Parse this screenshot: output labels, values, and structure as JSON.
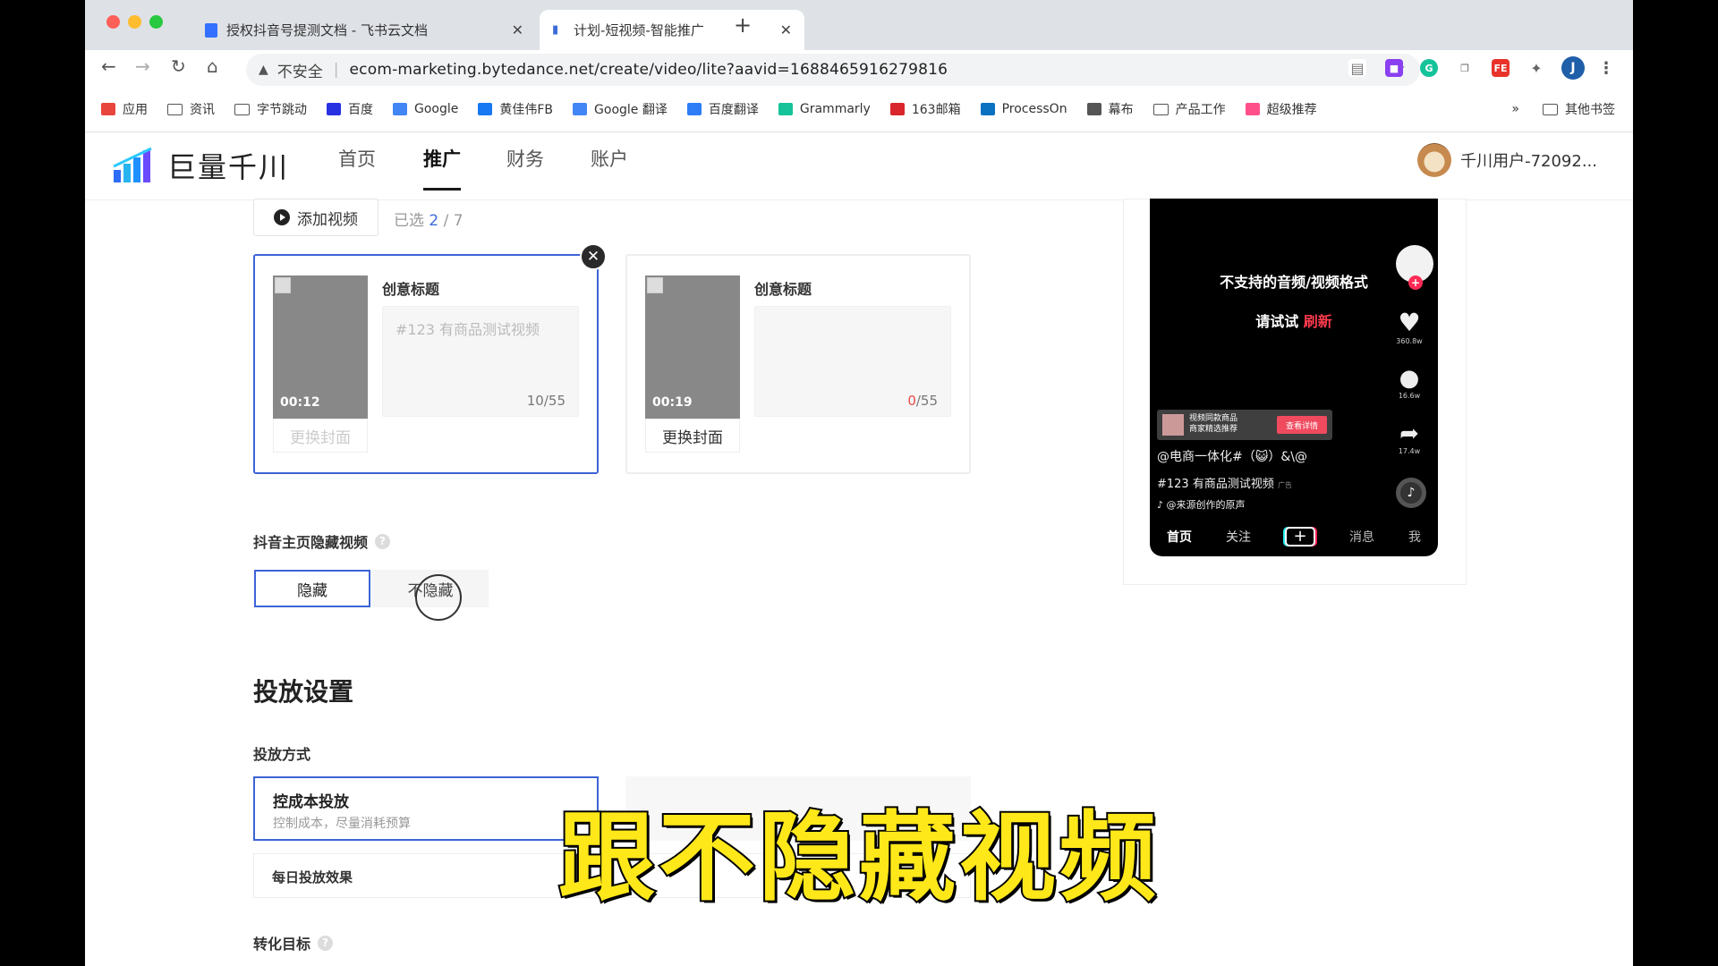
{
  "browser": {
    "tabs": [
      {
        "title": "授权抖音号提测文档 - 飞书云文档",
        "favicon_color": "#3370ff"
      },
      {
        "title": "计划-短视频-智能推广",
        "favicon_color": "#3b6bd8"
      }
    ],
    "security_label": "不安全",
    "url": "ecom-marketing.bytedance.net/create/video/lite?aavid=1688465916279816",
    "profile_initial": "J",
    "bookmarks": [
      {
        "label": "应用",
        "icon": "apps-grid-icon"
      },
      {
        "label": "资讯",
        "icon": "folder-icon"
      },
      {
        "label": "字节跳动",
        "icon": "folder-icon"
      },
      {
        "label": "百度",
        "icon": "baidu-icon"
      },
      {
        "label": "Google",
        "icon": "google-icon"
      },
      {
        "label": "黄佳伟FB",
        "icon": "facebook-icon"
      },
      {
        "label": "Google 翻译",
        "icon": "google-translate-icon"
      },
      {
        "label": "百度翻译",
        "icon": "baidu-translate-icon"
      },
      {
        "label": "Grammarly",
        "icon": "grammarly-icon"
      },
      {
        "label": "163邮箱",
        "icon": "mail163-icon"
      },
      {
        "label": "ProcessOn",
        "icon": "processon-icon"
      },
      {
        "label": "幕布",
        "icon": "mubu-icon"
      },
      {
        "label": "产品工作",
        "icon": "folder-icon"
      },
      {
        "label": "超级推荐",
        "icon": "share-icon"
      }
    ],
    "bookmarks_more": "»",
    "other_bookmarks": "其他书签"
  },
  "app": {
    "brand": "巨量千川",
    "nav": [
      "首页",
      "推广",
      "财务",
      "账户"
    ],
    "active_nav": "推广",
    "user_name": "千川用户-72092..."
  },
  "videos": {
    "add_label": "添加视频",
    "selected_prefix": "已选",
    "selected_count": "2",
    "selected_total": "/ 7",
    "cards": [
      {
        "duration": "00:12",
        "title_label": "创意标题",
        "text": "#123 有商品测试视频",
        "count_num": "10",
        "count_total": "/55",
        "cover_label": "更换封面"
      },
      {
        "duration": "00:19",
        "title_label": "创意标题",
        "text": "",
        "count_num": "0",
        "count_total": "/55",
        "cover_label": "更换封面"
      }
    ]
  },
  "hide_video": {
    "label": "抖音主页隐藏视频",
    "options": [
      "隐藏",
      "不隐藏"
    ],
    "selected": "隐藏"
  },
  "delivery": {
    "section_title": "投放设置",
    "method_label": "投放方式",
    "modes": [
      {
        "title": "控成本投放",
        "desc": "控制成本，尽量消耗预算"
      }
    ],
    "daily_label": "每日投放效果",
    "conversion_label": "转化目标"
  },
  "preview": {
    "msg_unsupported": "不支持的音频/视频格式",
    "msg_try": "请试试",
    "msg_refresh": "刷新",
    "likes": "360.8w",
    "comments": "16.6w",
    "shares": "17.4w",
    "product_title": "视频同款商品",
    "product_sub": "商家精选推荐",
    "product_btn": "查看详情",
    "author": "@电商一体化#（😺）&\\@",
    "caption": "#123 有商品测试视频",
    "ad_tag": "广告",
    "music": "@来源创作的原声",
    "tabs": [
      "首页",
      "关注",
      "+",
      "消息",
      "我"
    ]
  },
  "subtitle": "跟不隐藏视频",
  "colors": {
    "accent": "#3d63d6",
    "subtitle": "#ffe81a",
    "refresh": "#ff3b4e"
  }
}
